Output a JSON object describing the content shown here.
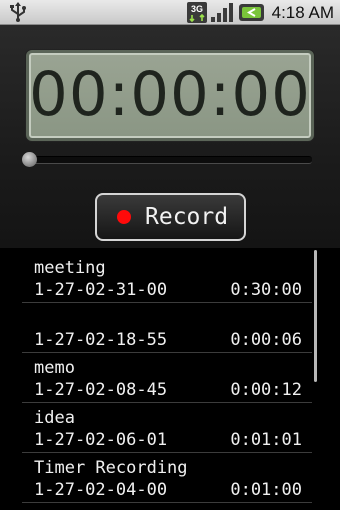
{
  "status_bar": {
    "time": "4:18 AM",
    "network_label": "3G",
    "icons": [
      "usb-icon",
      "3g-signal-icon",
      "signal-strength-icon",
      "battery-charging-icon"
    ]
  },
  "timer": {
    "display": "00:00:00"
  },
  "playback": {
    "progress": 0
  },
  "record_button": {
    "label": "Record",
    "dot_color": "#ff0a0a"
  },
  "recordings": [
    {
      "name": "meeting",
      "date": "1-27-02-31-00",
      "duration": "0:30:00"
    },
    {
      "name": "",
      "date": "1-27-02-18-55",
      "duration": "0:00:06"
    },
    {
      "name": "memo",
      "date": "1-27-02-08-45",
      "duration": "0:00:12"
    },
    {
      "name": "idea",
      "date": "1-27-02-06-01",
      "duration": "0:01:01"
    },
    {
      "name": "Timer Recording",
      "date": "1-27-02-04-00",
      "duration": "0:01:00"
    }
  ],
  "colors": {
    "background": "#000000",
    "lcd_background": "#9aa493",
    "lcd_digits": "#1f241e",
    "text": "#f0f0f0"
  }
}
